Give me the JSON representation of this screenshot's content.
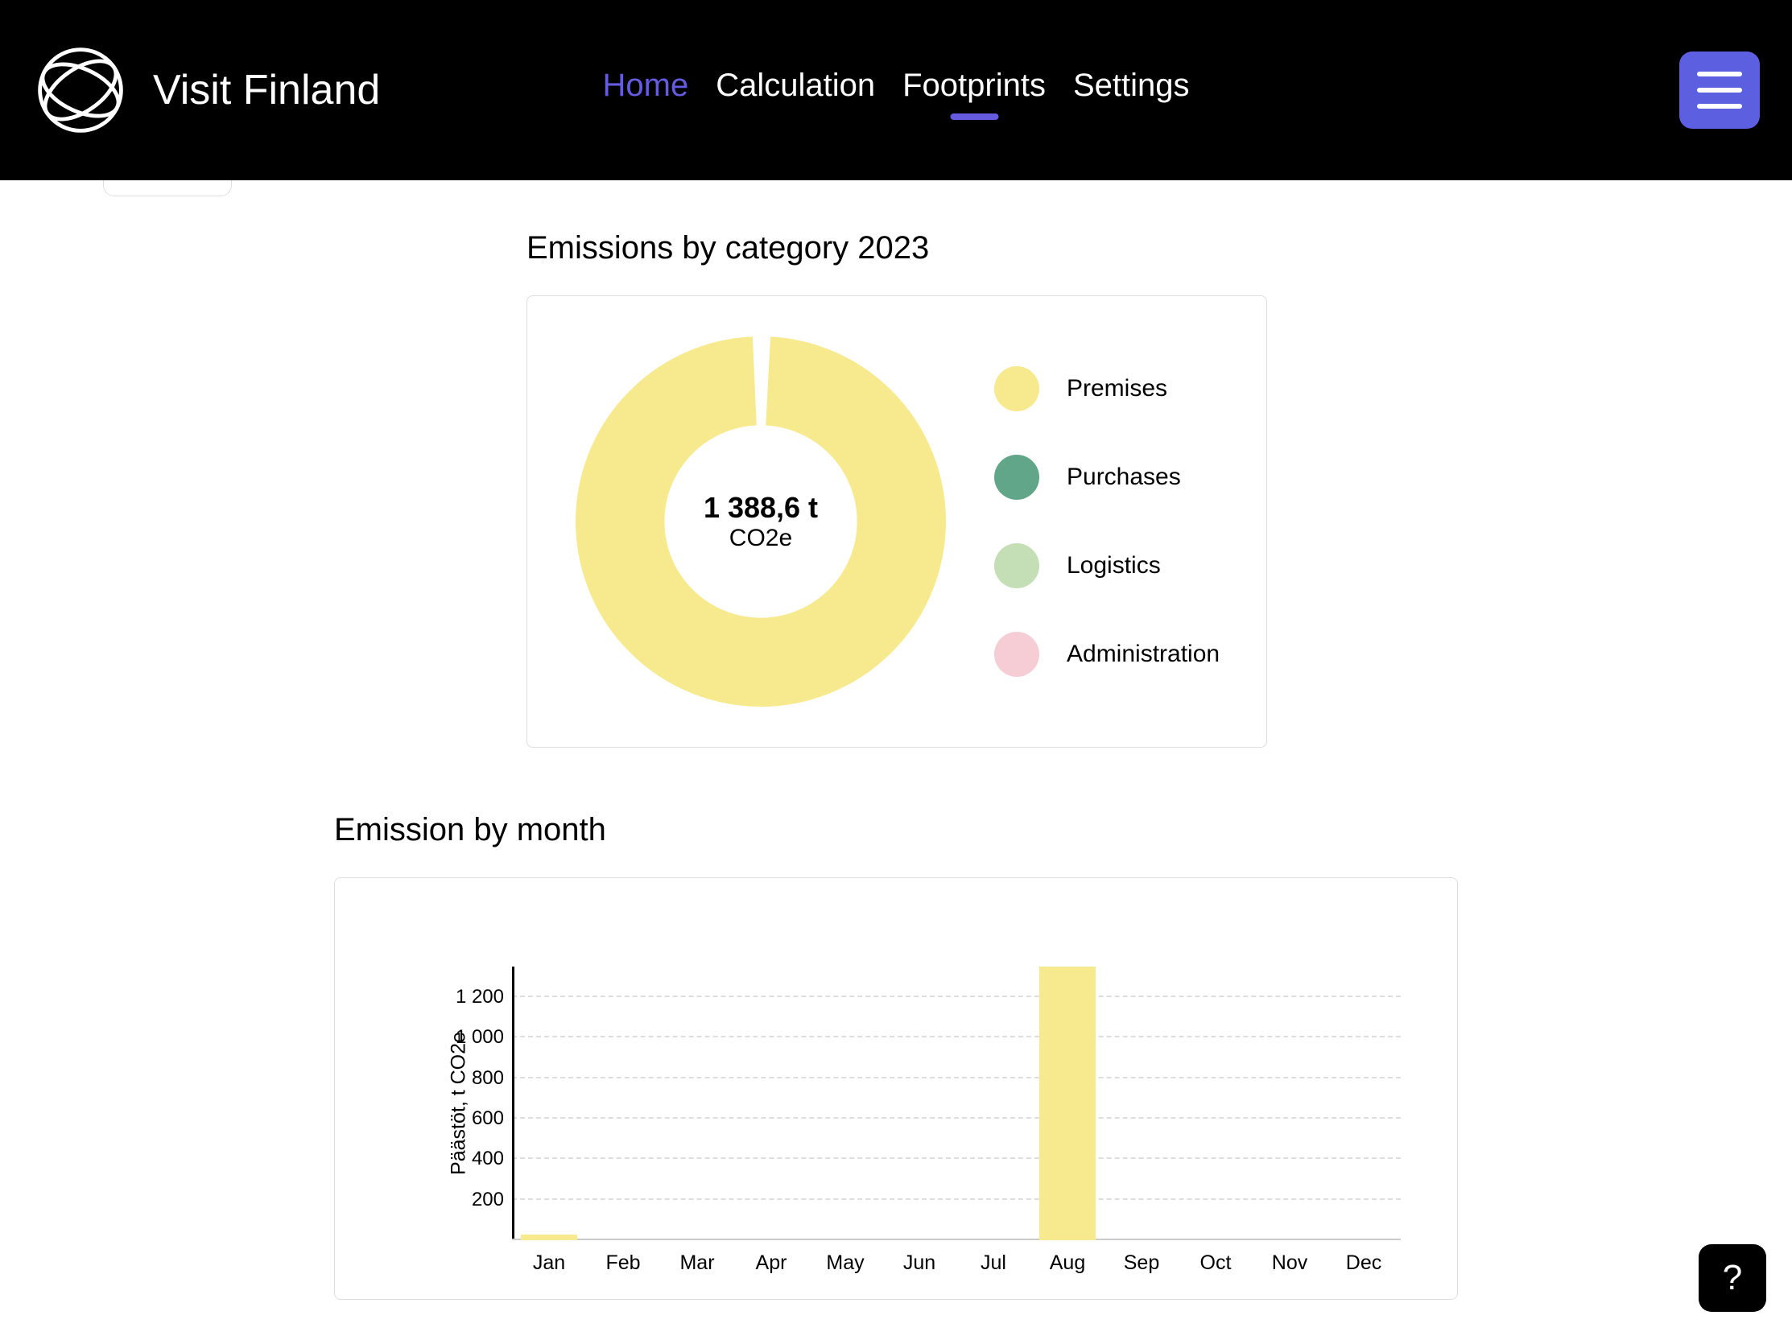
{
  "brand": {
    "name": "Visit Finland"
  },
  "nav": {
    "home": "Home",
    "calculation": "Calculation",
    "footprints": "Footprints",
    "settings": "Settings"
  },
  "help": {
    "label": "?"
  },
  "category_section": {
    "title": "Emissions by category 2023",
    "total_value": "1 388,6 t",
    "total_unit": "CO2e",
    "legend": {
      "premises": "Premises",
      "purchases": "Purchases",
      "logistics": "Logistics",
      "administration": "Administration"
    }
  },
  "colors": {
    "premises": "#f7e98e",
    "purchases": "#62a68a",
    "logistics": "#c4dfb5",
    "administration": "#f6cdd5",
    "accent": "#655be0"
  },
  "month_section": {
    "title": "Emission by month",
    "ylabel": "Päästöt, t CO2e",
    "yticks": {
      "t200": "200",
      "t400": "400",
      "t600": "600",
      "t800": "800",
      "t1000": "1 000",
      "t1200": "1 200"
    },
    "xticks": {
      "jan": "Jan",
      "feb": "Feb",
      "mar": "Mar",
      "apr": "Apr",
      "may": "May",
      "jun": "Jun",
      "jul": "Jul",
      "aug": "Aug",
      "sep": "Sep",
      "oct": "Oct",
      "nov": "Nov",
      "dec": "Dec"
    }
  },
  "chart_data": [
    {
      "type": "pie",
      "title": "Emissions by category 2023",
      "categories": [
        "Premises",
        "Purchases",
        "Logistics",
        "Administration"
      ],
      "values": [
        1388.6,
        0,
        0,
        0
      ],
      "total_label": "1 388,6 t",
      "sub_label": "CO2e",
      "colors": [
        "#f7e98e",
        "#62a68a",
        "#c4dfb5",
        "#f6cdd5"
      ]
    },
    {
      "type": "bar",
      "title": "Emission by month",
      "ylabel": "Päästöt, t CO2e",
      "ylim": [
        0,
        1350
      ],
      "y_ticks": [
        200,
        400,
        600,
        800,
        1000,
        1200
      ],
      "categories": [
        "Jan",
        "Feb",
        "Mar",
        "Apr",
        "May",
        "Jun",
        "Jul",
        "Aug",
        "Sep",
        "Oct",
        "Nov",
        "Dec"
      ],
      "values": [
        30,
        0,
        0,
        0,
        0,
        0,
        0,
        1350,
        0,
        0,
        0,
        0
      ],
      "color": "#f7e98e"
    }
  ]
}
